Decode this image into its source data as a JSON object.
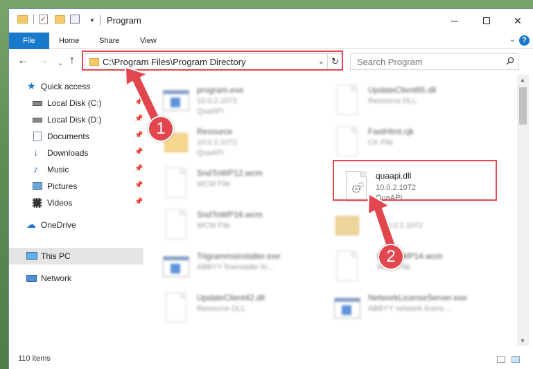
{
  "window": {
    "title": "Program"
  },
  "ribbon": {
    "tabs": [
      "File",
      "Home",
      "Share",
      "View"
    ],
    "help": "?"
  },
  "nav": {
    "address": "C:\\Program Files\\Program Directory",
    "search_placeholder": "Search Program"
  },
  "sidebar": {
    "items": [
      {
        "label": "Quick access",
        "icon": "star-icon"
      },
      {
        "label": "Local Disk (C:)",
        "icon": "drive-icon",
        "pinned": true
      },
      {
        "label": "Local Disk (D:)",
        "icon": "drive-icon",
        "pinned": true
      },
      {
        "label": "Documents",
        "icon": "documents-icon",
        "pinned": true
      },
      {
        "label": "Downloads",
        "icon": "download-icon",
        "pinned": true
      },
      {
        "label": "Music",
        "icon": "music-icon",
        "pinned": true
      },
      {
        "label": "Pictures",
        "icon": "pictures-icon",
        "pinned": true
      },
      {
        "label": "Videos",
        "icon": "videos-icon",
        "pinned": true
      },
      {
        "label": "OneDrive",
        "icon": "cloud-icon"
      },
      {
        "label": "This PC",
        "icon": "computer-icon",
        "selected": true
      },
      {
        "label": "Network",
        "icon": "network-icon"
      }
    ]
  },
  "files": [
    {
      "name": "program.exe",
      "line2": "10.0.2.1072",
      "line3": "QuaAPI",
      "type": "exe"
    },
    {
      "name": "UpdateClient65.dll",
      "line2": "Resource DLL",
      "line3": "",
      "type": "dll"
    },
    {
      "name": "Resource",
      "line2": "10.0.2.1072",
      "line3": "QuaAPI",
      "type": "folder"
    },
    {
      "name": "FastHtml.cjk",
      "line2": "CK File",
      "line3": "",
      "type": "doc"
    },
    {
      "name": "SndToWP12.wcm",
      "line2": "WCM File",
      "line3": "",
      "type": "doc"
    },
    {
      "name": "quaapi.dll",
      "line2": "10.0.2.1072",
      "line3": "QuaAPI",
      "type": "dll",
      "highlighted": true
    },
    {
      "name": "SndToWP16.wcm",
      "line2": "WCM File",
      "line3": "",
      "type": "doc"
    },
    {
      "name": "",
      "line2": "10.0.2.1072",
      "line3": "",
      "type": "folder"
    },
    {
      "name": "Trigrammsinstaller.exe",
      "line2": "ABBYY finereader tri...",
      "line3": "",
      "type": "exe"
    },
    {
      "name": "SndToWP14.wcm",
      "line2": "WCM File",
      "line3": "",
      "type": "doc"
    },
    {
      "name": "UpdateClient42.dll",
      "line2": "Resource DLL",
      "line3": "",
      "type": "dll"
    },
    {
      "name": "NetworkLicenseServer.exe",
      "line2": "ABBYY network licens...",
      "line3": "",
      "type": "exe"
    }
  ],
  "status": {
    "count": "110 items"
  },
  "annotations": {
    "step1": "1",
    "step2": "2",
    "color": "#e2474f"
  }
}
